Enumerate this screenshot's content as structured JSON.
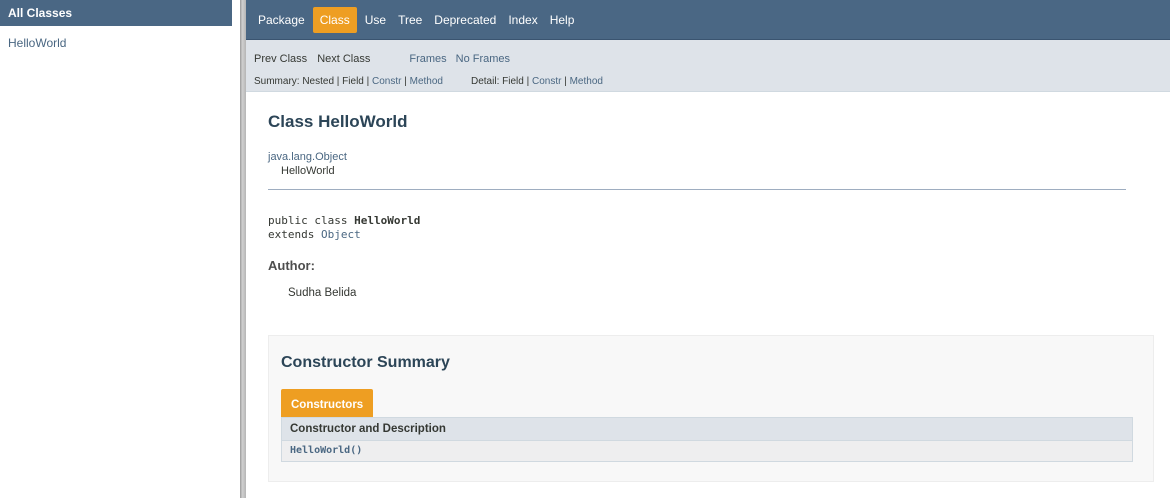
{
  "left_frame": {
    "title": "All Classes",
    "classes": [
      "HelloWorld"
    ]
  },
  "topnav": {
    "items": [
      "Package",
      "Class",
      "Use",
      "Tree",
      "Deprecated",
      "Index",
      "Help"
    ],
    "active": "Class"
  },
  "subnav": {
    "prev_class": "Prev Class",
    "next_class": "Next Class",
    "frames": "Frames",
    "no_frames": "No Frames",
    "summary_label": "Summary: Nested | Field |",
    "summary_constr": "Constr",
    "summary_sep": "|",
    "summary_method": "Method",
    "detail_label": "Detail: Field |",
    "detail_constr": "Constr",
    "detail_sep": "|",
    "detail_method": "Method"
  },
  "content": {
    "title": "Class HelloWorld",
    "inheritance_parent": "java.lang.Object",
    "inheritance_child": "HelloWorld",
    "signature_prefix": "public class ",
    "signature_class": "HelloWorld",
    "signature_extends": "extends ",
    "signature_parent": "Object",
    "author_label": "Author:",
    "author_name": "Sudha Belida"
  },
  "constructor_summary": {
    "title": "Constructor Summary",
    "tab_label": "Constructors",
    "table_header": "Constructor and Description",
    "rows": [
      "HelloWorld()"
    ]
  },
  "colors": {
    "nav_bg": "#4a6784",
    "accent_orange": "#ee9e22",
    "subnav_bg": "#dee3e9",
    "link": "#4a6782"
  }
}
